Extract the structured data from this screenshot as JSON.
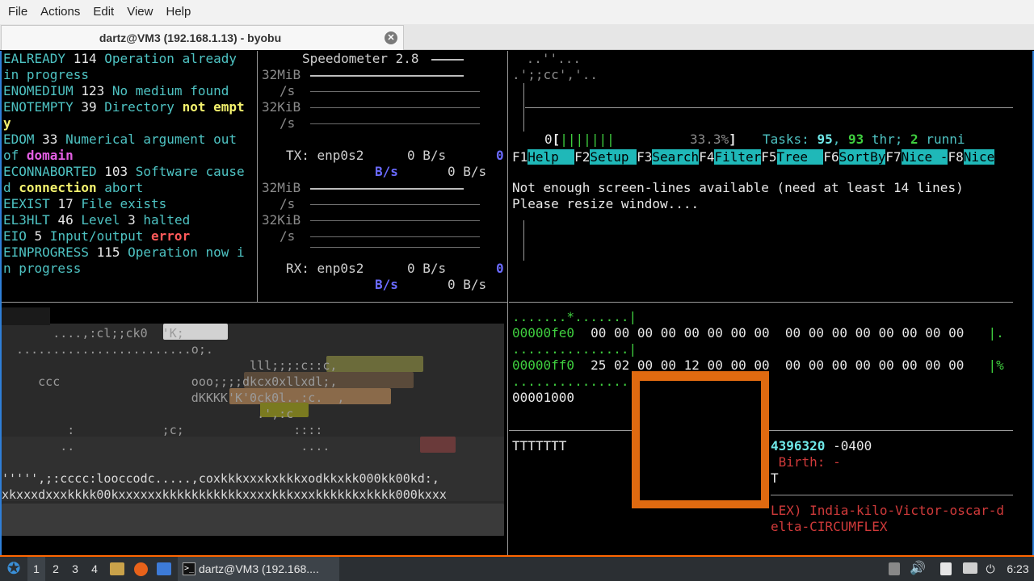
{
  "menubar": {
    "items": [
      "File",
      "Actions",
      "Edit",
      "View",
      "Help"
    ]
  },
  "tab": {
    "title": "dartz@VM3 (192.168.1.13) - byobu",
    "close_icon": "close-icon"
  },
  "errno_panel": {
    "lines": [
      [
        {
          "t": "EALREADY ",
          "c": "cyan"
        },
        {
          "t": "114",
          "c": "white"
        },
        {
          "t": " Operation already",
          "c": "cyan"
        }
      ],
      [
        {
          "t": "in progress",
          "c": "cyan"
        }
      ],
      [
        {
          "t": "ENOMEDIUM ",
          "c": "cyan"
        },
        {
          "t": "123",
          "c": "white"
        },
        {
          "t": " No medium found",
          "c": "cyan"
        }
      ],
      [
        {
          "t": "ENOTEMPTY ",
          "c": "cyan"
        },
        {
          "t": "39",
          "c": "white"
        },
        {
          "t": " Directory ",
          "c": "cyan"
        },
        {
          "t": "not empt",
          "c": "yellow"
        }
      ],
      [
        {
          "t": "y",
          "c": "yellow"
        }
      ],
      [
        {
          "t": "EDOM ",
          "c": "cyan"
        },
        {
          "t": "33",
          "c": "white"
        },
        {
          "t": " Numerical argument out",
          "c": "cyan"
        }
      ],
      [
        {
          "t": "of ",
          "c": "cyan"
        },
        {
          "t": "domain",
          "c": "magenta"
        }
      ],
      [
        {
          "t": "ECONNABORTED ",
          "c": "cyan"
        },
        {
          "t": "103",
          "c": "white"
        },
        {
          "t": " Software cause",
          "c": "cyan"
        }
      ],
      [
        {
          "t": "d ",
          "c": "cyan"
        },
        {
          "t": "connection",
          "c": "yellow"
        },
        {
          "t": " abort",
          "c": "cyan"
        }
      ],
      [
        {
          "t": "EEXIST ",
          "c": "cyan"
        },
        {
          "t": "17",
          "c": "white"
        },
        {
          "t": " File exists",
          "c": "cyan"
        }
      ],
      [
        {
          "t": "EL3HLT ",
          "c": "cyan"
        },
        {
          "t": "46",
          "c": "white"
        },
        {
          "t": " Level ",
          "c": "cyan"
        },
        {
          "t": "3",
          "c": "white"
        },
        {
          "t": " halted",
          "c": "cyan"
        }
      ],
      [
        {
          "t": "EIO ",
          "c": "cyan"
        },
        {
          "t": "5",
          "c": "white"
        },
        {
          "t": " Input/output ",
          "c": "cyan"
        },
        {
          "t": "error",
          "c": "red"
        }
      ],
      [
        {
          "t": "EINPROGRESS ",
          "c": "cyan"
        },
        {
          "t": "115",
          "c": "white"
        },
        {
          "t": " Operation now i",
          "c": "cyan"
        }
      ],
      [
        {
          "t": "n progress",
          "c": "cyan"
        }
      ]
    ]
  },
  "speedometer": {
    "title": "Speedometer 2.8",
    "units": [
      "32MiB",
      "/s",
      "32KiB",
      "/s"
    ],
    "tx": {
      "label": "TX: enp0s2",
      "rate": "0 B/s",
      "zero": "0",
      "unit_bs": "B/s",
      "rate2": "0 B/s"
    },
    "rx": {
      "label": "RX: enp0s2",
      "rate": "0 B/s",
      "zero": "0",
      "unit_bs": "B/s",
      "rate2": "0 B/s"
    }
  },
  "htop": {
    "logo_lines": [
      " ..''...",
      ".';;cc','.."
    ],
    "cpu_label": "0",
    "cpu_bars": "[|||||||",
    "cpu_percent": "33.3%]",
    "tasks_prefix": "Tasks: ",
    "tasks": "95",
    "sep1": ", ",
    "threads": "93",
    "thr_label": " thr; ",
    "running": "2",
    "run_label": " runni",
    "fkeys": [
      {
        "k": "F1",
        "l": "Help  "
      },
      {
        "k": "F2",
        "l": "Setup "
      },
      {
        "k": "F3",
        "l": "Search"
      },
      {
        "k": "F4",
        "l": "Filter"
      },
      {
        "k": "F5",
        "l": "Tree  "
      },
      {
        "k": "F6",
        "l": "SortBy"
      },
      {
        "k": "F7",
        "l": "Nice -"
      },
      {
        "k": "F8",
        "l": "Nice"
      }
    ],
    "message_lines": [
      "Not enough screen-lines available (need at least 14 lines)",
      "Please resize window...."
    ]
  },
  "art": {
    "lines": [
      "",
      "       ....,:cl;;ck0  'K;",
      "  ........................o;.",
      "                                  lll;;;:c::c,",
      "     ccc                  ooo;;;;dkcx0xllxdl;,",
      "                          dKKKK'K'0ck0l..:c.  ,",
      "                                   .',:c",
      "         :            ;c;               ::::",
      "        ..                               ....",
      "",
      "''''',;:cccc:looccodc.....,coxkkkxxxkxkkkxodkkxkk000kk00kd:,",
      "xkxxxdxxxkkkk00kxxxxxxkkkkkkkkkkkxxxxkkkxxxkkkkkkxkkkk000kxxx"
    ]
  },
  "hexdump": {
    "lines": [
      {
        "dots": ".......*.......|"
      },
      {
        "addr": "00000fe0",
        "bytes": "00 00 00 00 00 00 00 00  00 00 00 00 00 00 00 00",
        "tail": "|."
      },
      {
        "dots": "...............|"
      },
      {
        "addr": "00000ff0",
        "bytes": "25 02 00 00 12 00 00 00  00 00 00 00 00 00 00 00",
        "tail": "|%"
      },
      {
        "dots": "...............|"
      },
      {
        "addr": "00001000"
      }
    ]
  },
  "bottom_right": {
    "t_line": "TTTTTTT",
    "stat_num": "4396320",
    "stat_tz": " -0400",
    "birth": " Birth: -",
    "t_char": "T",
    "nato_lines": [
      "LEX) India-kilo-Victor-oscar-d",
      "elta-CIRCUMFLEX"
    ]
  },
  "taskbar": {
    "start_icon": "distro-logo-icon",
    "workspaces": [
      "1",
      "2",
      "3",
      "4"
    ],
    "active_workspace": "1",
    "window_label": "dartz@VM3 (192.168....",
    "clock": "6:23",
    "colors": {
      "accent": "#ff6600",
      "panel": "#2b2f33"
    }
  }
}
